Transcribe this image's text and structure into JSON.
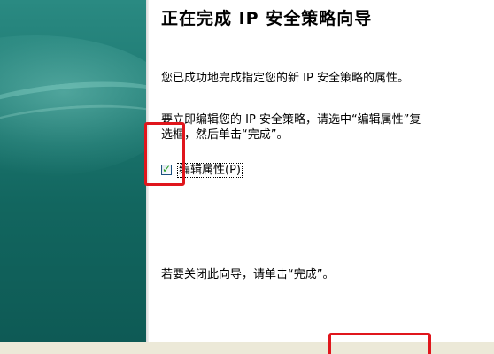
{
  "wizard": {
    "title": "正在完成 IP 安全策略向导",
    "completed_text": "您已成功地完成指定您的新 IP 安全策略的属性。",
    "edit_instruction_line1": "要立即编辑您的 IP 安全策略，请选中“编辑属性”复",
    "edit_instruction_line2": "选框，然后单击“完成”。",
    "edit_properties_checkbox": {
      "label": "编辑属性(P)",
      "checked": true
    },
    "close_instruction": "若要关闭此向导，请单击“完成”。"
  },
  "colors": {
    "side_panel": "#12665f",
    "highlight": "#e0161c",
    "checkmark": "#21a121"
  }
}
